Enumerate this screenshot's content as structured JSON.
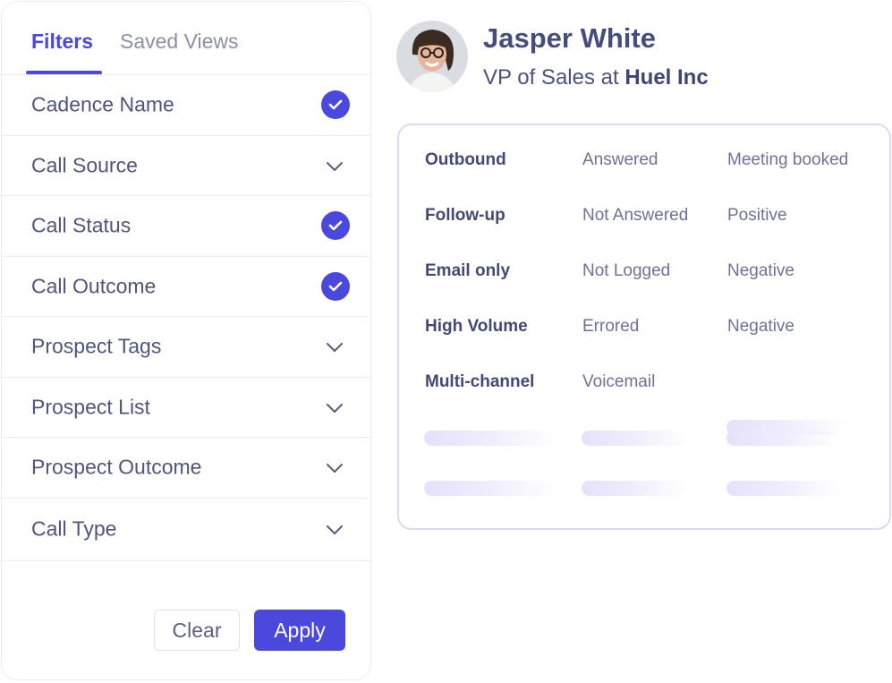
{
  "filters_panel": {
    "tabs": [
      {
        "label": "Filters",
        "active": true
      },
      {
        "label": "Saved Views",
        "active": false
      }
    ],
    "items": [
      {
        "label": "Cadence Name",
        "state": "checked",
        "icon": "check-circle-icon"
      },
      {
        "label": "Call Source",
        "state": "collapsed",
        "icon": "chevron-down-icon"
      },
      {
        "label": "Call Status",
        "state": "checked",
        "icon": "check-circle-icon"
      },
      {
        "label": "Call Outcome",
        "state": "checked",
        "icon": "check-circle-icon"
      },
      {
        "label": "Prospect Tags",
        "state": "collapsed",
        "icon": "chevron-down-icon"
      },
      {
        "label": "Prospect List",
        "state": "collapsed",
        "icon": "chevron-down-icon"
      },
      {
        "label": "Prospect Outcome",
        "state": "collapsed",
        "icon": "chevron-down-icon"
      },
      {
        "label": "Call Type",
        "state": "collapsed",
        "icon": "chevron-down-icon"
      }
    ],
    "buttons": {
      "clear": "Clear",
      "apply": "Apply"
    }
  },
  "profile": {
    "name": "Jasper White",
    "role_prefix": "VP of Sales at ",
    "company": "Huel Inc",
    "avatar": "person-photo"
  },
  "card": {
    "rows": [
      [
        "Outbound",
        "Answered",
        "Meeting booked"
      ],
      [
        "Follow-up",
        "Not Answered",
        "Positive"
      ],
      [
        "Email only",
        "Not Logged",
        "Negative"
      ],
      [
        "High Volume",
        "Errored",
        "Negative"
      ],
      [
        "Multi-channel",
        "Voicemail",
        null
      ]
    ],
    "placeholder_rows": 2
  },
  "colors": {
    "accent": "#4b48dd",
    "text": "#50557a",
    "muted": "#8c8fa8",
    "border": "#ececf8",
    "skeleton": "#e4e1fb"
  }
}
